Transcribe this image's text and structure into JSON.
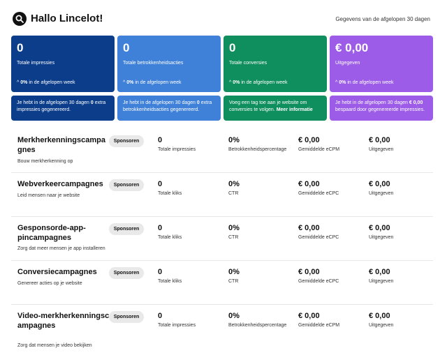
{
  "header": {
    "greeting": "Hallo Lincelot!",
    "period": "Gegevens van de afgelopen 30 dagen",
    "logo_icon": "search-icon"
  },
  "cards": [
    {
      "value": "0",
      "label": "Totale impressies",
      "delta_value": "0%",
      "delta_text": " in de afgelopen week",
      "color": "#0b3d8a"
    },
    {
      "value": "0",
      "label": "Totale betrokkenheidsacties",
      "delta_value": "0%",
      "delta_text": " in de afgelopen week",
      "color": "#3f80d8"
    },
    {
      "value": "0",
      "label": "Totale conversies",
      "delta_value": "0%",
      "delta_text": " in de afgelopen week",
      "color": "#0f8e5e"
    },
    {
      "value": "€ 0,00",
      "label": "Uitgegeven",
      "delta_value": "0%",
      "delta_text": " in de afgelopen week",
      "color": "#9c5ce8"
    }
  ],
  "notes": [
    {
      "pre": "Je hebt in de afgelopen 30 dagen ",
      "bold": "0",
      "post": " extra impressies gegenereerd."
    },
    {
      "pre": "Je hebt in de afgelopen 30 dagen ",
      "bold": "0",
      "post": " extra betrokkenheidsacties gegenereerd."
    },
    {
      "pre": "Voeg een tag toe aan je website om conversies te volgen. ",
      "bold": "Meer informatie",
      "post": ""
    },
    {
      "pre": "Je hebt in de afgelopen 30 dagen ",
      "bold": "€ 0,00",
      "post": " bespaard door gegenereerde impressies."
    }
  ],
  "sponsor_label": "Sponsoren",
  "campaigns": [
    {
      "title": "Merkherkenningscampagnes",
      "subtitle": "Bouw merkherkenning op",
      "metrics": [
        {
          "value": "0",
          "label": "Totale impressies"
        },
        {
          "value": "0%",
          "label": "Betrokkenheidspercentage"
        },
        {
          "value": "€ 0,00",
          "label": "Gemiddelde eCPM"
        },
        {
          "value": "€ 0,00",
          "label": "Uitgegeven"
        }
      ]
    },
    {
      "title": "Webverkeercampagnes",
      "subtitle": "Leid mensen naar je website",
      "metrics": [
        {
          "value": "0",
          "label": "Totale kliks"
        },
        {
          "value": "0%",
          "label": "CTR"
        },
        {
          "value": "€ 0,00",
          "label": "Gemiddelde eCPC"
        },
        {
          "value": "€ 0,00",
          "label": "Uitgegeven"
        }
      ]
    },
    {
      "title": "Gesponsorde-app-pincampagnes",
      "subtitle": "Zorg dat meer mensen je app installeren",
      "metrics": [
        {
          "value": "0",
          "label": "Totale kliks"
        },
        {
          "value": "0%",
          "label": "CTR"
        },
        {
          "value": "€ 0,00",
          "label": "Gemiddelde eCPC"
        },
        {
          "value": "€ 0,00",
          "label": "Uitgegeven"
        }
      ]
    },
    {
      "title": "Conversiecampagnes",
      "subtitle": "Genereer acties op je website",
      "metrics": [
        {
          "value": "0",
          "label": "Totale kliks"
        },
        {
          "value": "0%",
          "label": "CTR"
        },
        {
          "value": "€ 0,00",
          "label": "Gemiddelde eCPC"
        },
        {
          "value": "€ 0,00",
          "label": "Uitgegeven"
        }
      ]
    },
    {
      "title": "Video-merkherkenningscampagnes",
      "subtitle": "Zorg dat mensen je video bekijken",
      "metrics": [
        {
          "value": "0",
          "label": "Totale impressies"
        },
        {
          "value": "0%",
          "label": "Betrokkenheidspercentage"
        },
        {
          "value": "€ 0,00",
          "label": "Gemiddelde eCPM"
        },
        {
          "value": "€ 0,00",
          "label": "Uitgegeven"
        }
      ]
    }
  ]
}
